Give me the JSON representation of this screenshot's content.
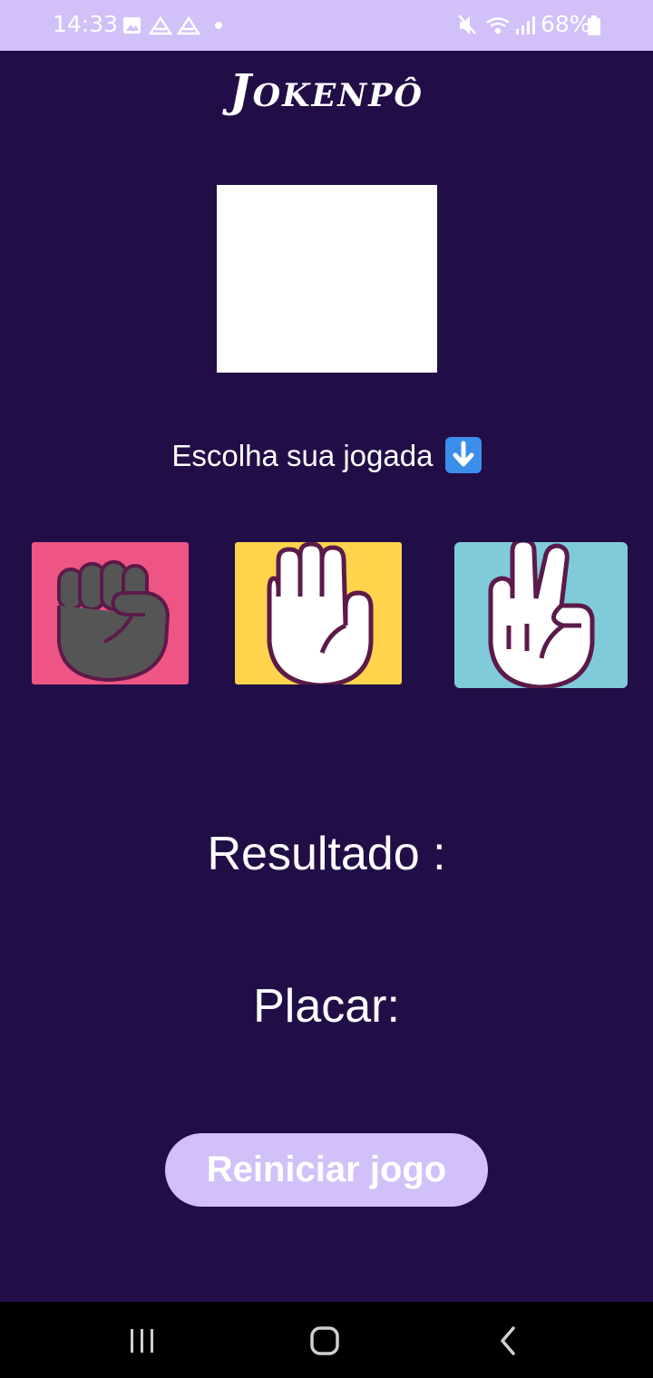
{
  "status_bar": {
    "time": "14:33",
    "battery_text": "68%",
    "icons_left": [
      "image-icon",
      "drive-icon",
      "drive-icon",
      "dot-icon"
    ],
    "icons_right": [
      "mute-icon",
      "wifi-icon",
      "signal-icon",
      "battery-icon"
    ]
  },
  "app": {
    "title": "Jokenpô",
    "prompt": "Escolha sua jogada",
    "prompt_icon": "down-arrow-emoji-icon",
    "choices": [
      {
        "name": "rock",
        "icon": "rock-hand-icon",
        "color": "#EE5584"
      },
      {
        "name": "paper",
        "icon": "paper-hand-icon",
        "color": "#FFD44C"
      },
      {
        "name": "scissors",
        "icon": "scissors-hand-icon",
        "color": "#7FCBD9"
      }
    ],
    "result_label": "Resultado :",
    "score_label": "Placar:",
    "restart_label": "Reiniciar jogo"
  },
  "colors": {
    "background": "#220E47",
    "accent": "#D2C0F9",
    "text": "#FFFFFF"
  },
  "nav_bar": {
    "buttons": [
      "recents-icon",
      "home-icon",
      "back-icon"
    ]
  }
}
